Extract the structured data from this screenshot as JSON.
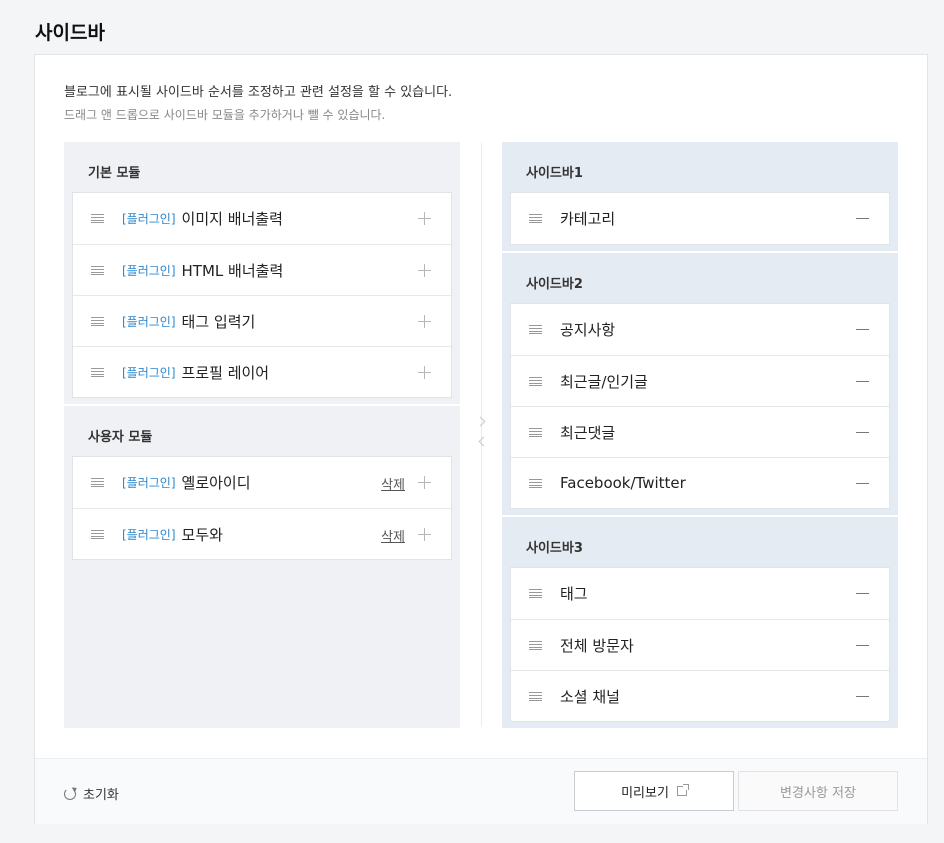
{
  "page": {
    "title": "사이드바"
  },
  "description": {
    "main": "블로그에 표시될 사이드바 순서를 조정하고 관련 설정을 할 수 있습니다.",
    "sub": "드래그 앤 드롭으로 사이드바 모듈을 추가하거나 뺄 수 있습니다."
  },
  "basic_modules": {
    "title": "기본 모듈",
    "items": [
      {
        "tag": "[플러그인]",
        "name": "이미지 배너출력"
      },
      {
        "tag": "[플러그인]",
        "name": "HTML 배너출력"
      },
      {
        "tag": "[플러그인]",
        "name": "태그 입력기"
      },
      {
        "tag": "[플러그인]",
        "name": "프로필 레이어"
      }
    ]
  },
  "user_modules": {
    "title": "사용자 모듈",
    "delete_label": "삭제",
    "items": [
      {
        "tag": "[플러그인]",
        "name": "옐로아이디"
      },
      {
        "tag": "[플러그인]",
        "name": "모두와"
      }
    ]
  },
  "sidebar1": {
    "title": "사이드바1",
    "items": [
      "카테고리"
    ]
  },
  "sidebar2": {
    "title": "사이드바2",
    "items": [
      "공지사항",
      "최근글/인기글",
      "최근댓글",
      "Facebook/Twitter"
    ]
  },
  "sidebar3": {
    "title": "사이드바3",
    "items": [
      "태그",
      "전체 방문자",
      "소셜 채널"
    ]
  },
  "footer": {
    "reset_label": "초기화",
    "preview_label": "미리보기",
    "save_label": "변경사항 저장"
  },
  "icons": {
    "drag": "drag-handle-icon",
    "add": "plus-icon",
    "remove": "minus-icon",
    "reset": "refresh-icon",
    "external": "external-link-icon"
  }
}
